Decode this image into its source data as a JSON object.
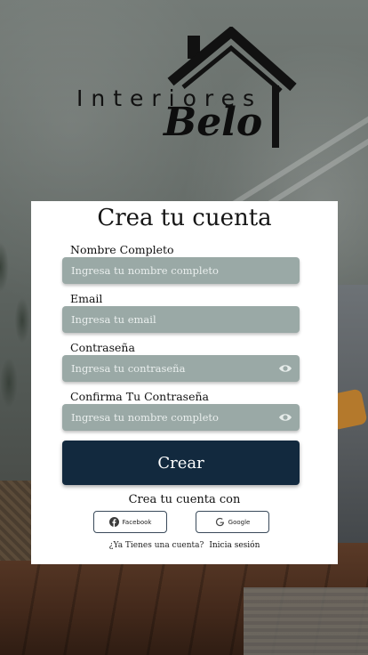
{
  "brand": {
    "word": "Interiores",
    "name": "Belo"
  },
  "form": {
    "title": "Crea tu cuenta",
    "fields": [
      {
        "label": "Nombre Completo",
        "placeholder": "Ingresa tu nombre completo"
      },
      {
        "label": "Email",
        "placeholder": "Ingresa tu email"
      },
      {
        "label": "Contraseña",
        "placeholder": "Ingresa tu contraseña"
      },
      {
        "label": "Confirma Tu Contraseña",
        "placeholder": "Ingresa tu nombre completo"
      }
    ],
    "submit_label": "Crear",
    "social_prompt": "Crea tu cuenta con",
    "social": {
      "facebook_label": "Facebook",
      "google_label": "Google"
    },
    "footer": {
      "question": "¿Ya Tienes una cuenta?",
      "login_link": "Inicia sesión"
    }
  },
  "icons": {
    "password_toggle": "eye-icon",
    "facebook": "facebook-icon",
    "google": "google-icon"
  },
  "colors": {
    "input_bg": "#9aa9a6",
    "button_bg": "#12293e",
    "card_bg": "#ffffff"
  }
}
